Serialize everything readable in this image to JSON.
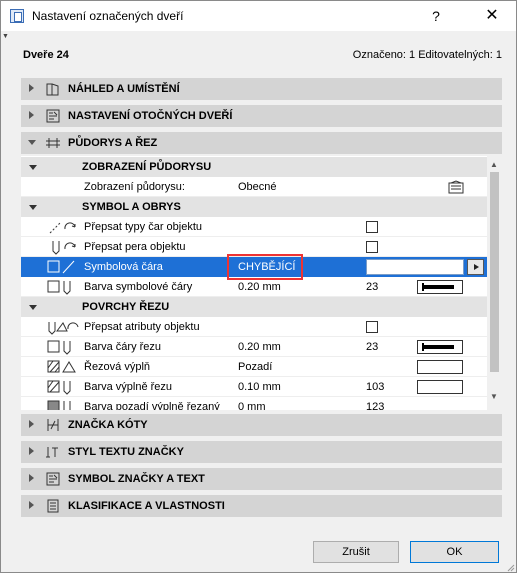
{
  "window": {
    "title": "Nastavení označených dveří",
    "help_label": "?",
    "close_label": "✕"
  },
  "header": {
    "object_name": "Dveře 24",
    "selection_info": "Označeno: 1 Editovatelných: 1"
  },
  "sections_top": [
    {
      "label": "NÁHLED A UMÍSTĚNÍ",
      "icon": "preview-icon"
    },
    {
      "label": "NASTAVENÍ OTOČNÝCH DVEŘÍ",
      "icon": "door-settings-icon"
    },
    {
      "label": "PŮDORYS A ŘEZ",
      "icon": "floorplan-section-icon",
      "expanded": true
    }
  ],
  "panel": {
    "sub_floorplan": "ZOBRAZENÍ PŮDORYSU",
    "floorplan_display_label": "Zobrazení půdorysu:",
    "floorplan_display_value": "Obecné",
    "sub_symbol": "SYMBOL A OBRYS",
    "override_line_types": "Přepsat typy čar objektu",
    "override_pens": "Přepsat pera objektu",
    "symbol_line_label": "Symbolová čára",
    "symbol_line_value": "CHYBĚJÍCÍ",
    "symbol_line_color_label": "Barva symbolové čáry",
    "symbol_line_color_value": "0.20 mm",
    "symbol_line_color_pen": "23",
    "sub_cut": "POVRCHY ŘEZU",
    "override_attrs": "Přepsat atributy objektu",
    "cut_line_color_label": "Barva čáry řezu",
    "cut_line_color_value": "0.20 mm",
    "cut_line_color_pen": "23",
    "cut_fill_label": "Řezová výplň",
    "cut_fill_value": "Pozadí",
    "cut_fill_color_label": "Barva výplně řezu",
    "cut_fill_color_value": "0.10 mm",
    "cut_fill_color_pen": "103",
    "cut_fill_bg_label": "Barva pozadí výplně řezaný",
    "cut_fill_bg_value": "0 mm",
    "cut_fill_bg_pen": "123"
  },
  "sections_bottom": [
    {
      "label": "ZNAČKA KÓTY",
      "icon": "dimension-marker-icon"
    },
    {
      "label": "STYL TEXTU ZNAČKY",
      "icon": "text-style-icon"
    },
    {
      "label": "SYMBOL ZNAČKY A TEXT",
      "icon": "marker-symbol-icon"
    },
    {
      "label": "KLASIFIKACE A VLASTNOSTI",
      "icon": "classification-icon"
    }
  ],
  "buttons": {
    "cancel": "Zrušit",
    "ok": "OK"
  },
  "colors": {
    "selection": "#1e70d6",
    "highlight_box": "#e33333",
    "section_bg": "#d4d4d4"
  }
}
